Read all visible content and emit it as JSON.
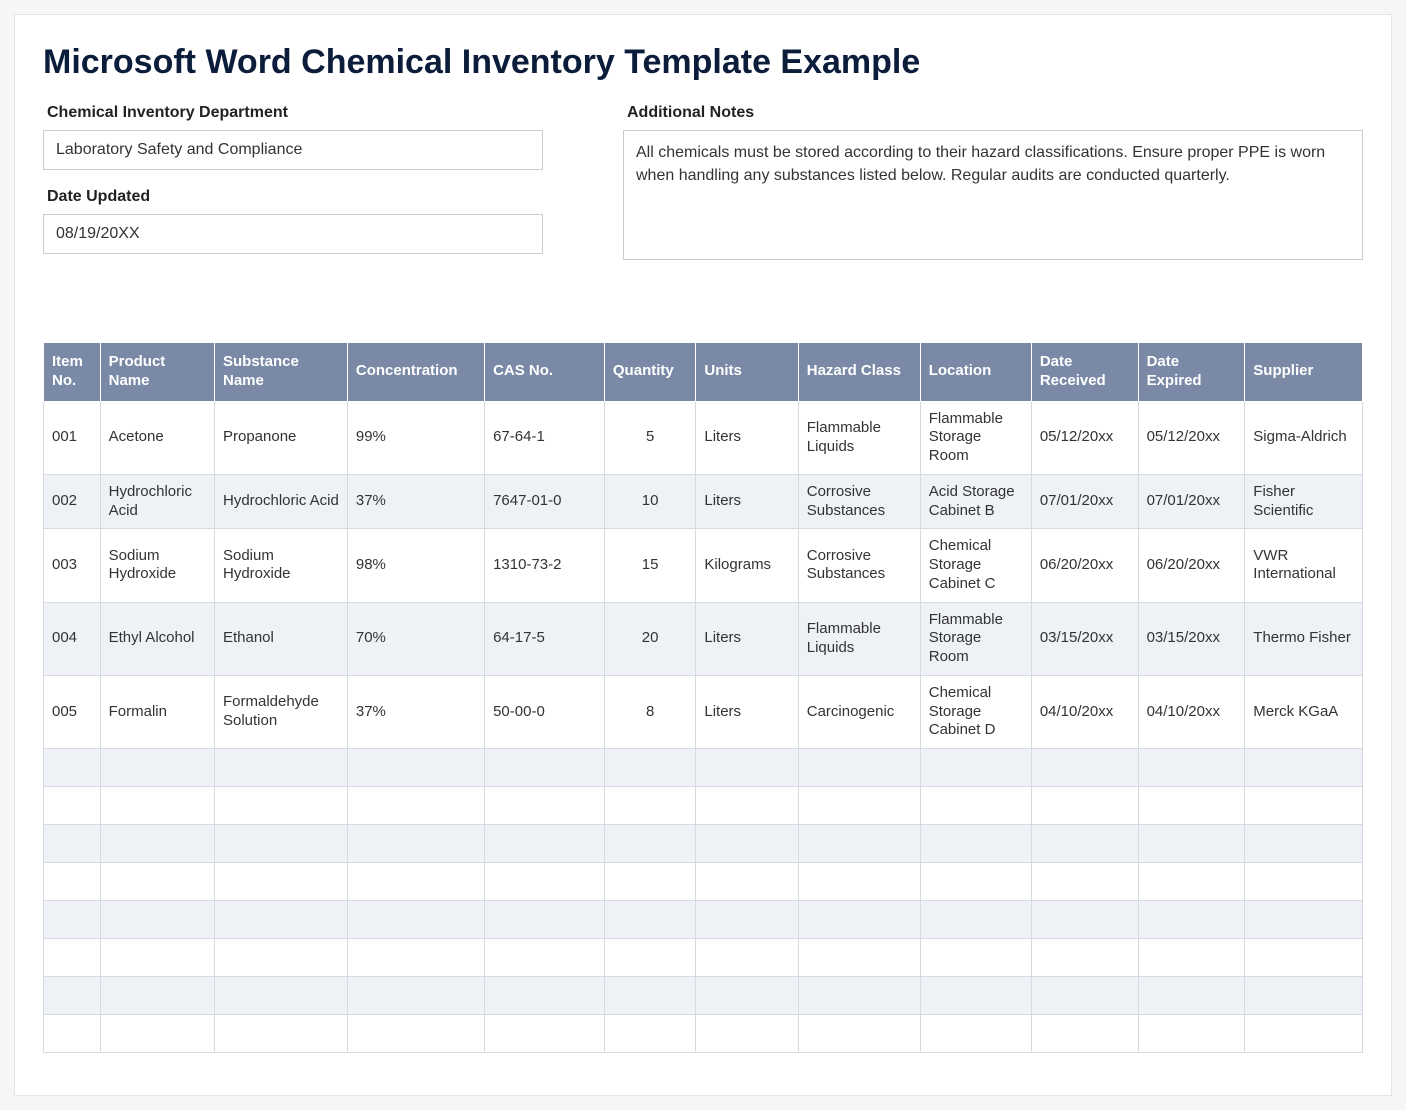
{
  "title": "Microsoft Word Chemical Inventory Template Example",
  "fields": {
    "department_label": "Chemical Inventory Department",
    "department_value": "Laboratory Safety and Compliance",
    "date_updated_label": "Date Updated",
    "date_updated_value": "08/19/20XX",
    "notes_label": "Additional Notes",
    "notes_value": "All chemicals must be stored according to their hazard classifications. Ensure proper PPE is worn when handling any substances listed below. Regular audits are conducted quarterly."
  },
  "table": {
    "headers": {
      "item_no": "Item No.",
      "product_name": "Product Name",
      "substance_name": "Substance Name",
      "concentration": "Concentration",
      "cas_no": "CAS No.",
      "quantity": "Quantity",
      "units": "Units",
      "hazard_class": "Hazard Class",
      "location": "Location",
      "date_received": "Date Received",
      "date_expired": "Date Expired",
      "supplier": "Supplier"
    },
    "rows": [
      {
        "item_no": "001",
        "product_name": "Acetone",
        "substance_name": "Propanone",
        "concentration": "99%",
        "cas_no": "67-64-1",
        "quantity": "5",
        "units": "Liters",
        "hazard_class": "Flammable Liquids",
        "location": "Flammable Storage Room",
        "date_received": "05/12/20xx",
        "date_expired": "05/12/20xx",
        "supplier": "Sigma-Aldrich"
      },
      {
        "item_no": "002",
        "product_name": "Hydrochloric Acid",
        "substance_name": "Hydrochloric Acid",
        "concentration": "37%",
        "cas_no": "7647-01-0",
        "quantity": "10",
        "units": "Liters",
        "hazard_class": "Corrosive Substances",
        "location": "Acid Storage Cabinet B",
        "date_received": "07/01/20xx",
        "date_expired": "07/01/20xx",
        "supplier": "Fisher Scientific"
      },
      {
        "item_no": "003",
        "product_name": "Sodium Hydroxide",
        "substance_name": "Sodium Hydroxide",
        "concentration": "98%",
        "cas_no": "1310-73-2",
        "quantity": "15",
        "units": "Kilograms",
        "hazard_class": "Corrosive Substances",
        "location": "Chemical Storage Cabinet C",
        "date_received": "06/20/20xx",
        "date_expired": "06/20/20xx",
        "supplier": "VWR International"
      },
      {
        "item_no": "004",
        "product_name": "Ethyl Alcohol",
        "substance_name": "Ethanol",
        "concentration": "70%",
        "cas_no": "64-17-5",
        "quantity": "20",
        "units": "Liters",
        "hazard_class": "Flammable Liquids",
        "location": "Flammable Storage Room",
        "date_received": "03/15/20xx",
        "date_expired": "03/15/20xx",
        "supplier": "Thermo Fisher"
      },
      {
        "item_no": "005",
        "product_name": "Formalin",
        "substance_name": "Formaldehyde Solution",
        "concentration": "37%",
        "cas_no": "50-00-0",
        "quantity": "8",
        "units": "Liters",
        "hazard_class": "Carcinogenic",
        "location": "Chemical Storage Cabinet D",
        "date_received": "04/10/20xx",
        "date_expired": "04/10/20xx",
        "supplier": "Merck KGaA"
      }
    ],
    "empty_rows": 8
  }
}
